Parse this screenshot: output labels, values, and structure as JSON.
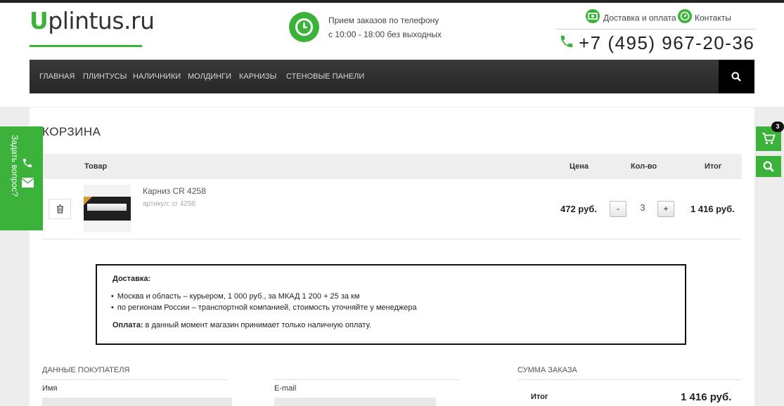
{
  "header": {
    "logo_first": "U",
    "logo_rest": "plintus.ru",
    "order_line1": "Прием заказов по телефону",
    "order_line2": "с 10:00 - 18:00 без выходных",
    "delivery_link": "Доставка и оплата",
    "contacts_link": "Контакты",
    "phone": "+7 (495) 967-20-36"
  },
  "nav": {
    "items": [
      "ГЛАВНАЯ",
      "ПЛИНТУСЫ",
      "НАЛИЧНИКИ",
      "МОЛДИНГИ",
      "КАРНИЗЫ",
      "СТЕНОВЫЕ ПАНЕЛИ"
    ]
  },
  "cart": {
    "title": "КОРЗИНА",
    "columns": {
      "product": "Товар",
      "price": "Цена",
      "qty": "Кол-во",
      "total": "Итог"
    },
    "items": [
      {
        "name": "Карниз CR 4258",
        "article": "артикул: cr 4258",
        "price": "472 руб.",
        "qty": "3",
        "total": "1 416 руб."
      }
    ],
    "minus_label": "-",
    "plus_label": "+"
  },
  "delivery": {
    "title": "Доставка:",
    "items": [
      "Москва и область – курьером, 1 000 руб., за МКАД 1 200 + 25 за км",
      "по регионам России – транспортной компанией, стоимость уточняйте у менеджера"
    ],
    "payment_label": "Оплата:",
    "payment_text": " в данный момент магазин принимает только наличную оплату."
  },
  "buyer": {
    "title": "ДАННЫЕ ПОКУПАТЕЛЯ",
    "name_label": "Имя",
    "email_label": "E-mail"
  },
  "summary": {
    "title": "СУММА ЗАКАЗА",
    "total_label": "Итог",
    "total_value": "1 416 руб."
  },
  "side_tab": {
    "label": "Задать вопрос?"
  },
  "floating": {
    "cart_count": "3"
  },
  "colors": {
    "accent": "#3bb33b",
    "nav_bg": "#2f2f2f"
  }
}
